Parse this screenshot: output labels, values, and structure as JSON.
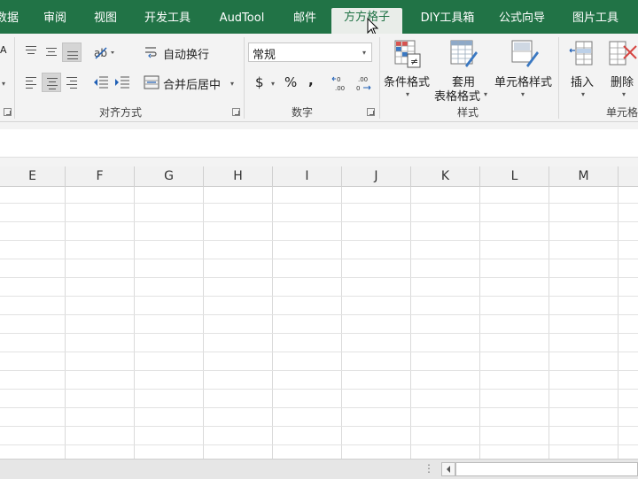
{
  "tabs": [
    "数据",
    "审阅",
    "视图",
    "开发工具",
    "AudTool",
    "邮件",
    "方方格子",
    "DIY工具箱",
    "公式向导",
    "图片工具"
  ],
  "active_tab": "方方格子",
  "alignment": {
    "wrap_text": "自动换行",
    "merge_center": "合并后居中",
    "group_label": "对齐方式"
  },
  "number": {
    "format_value": "常规",
    "currency_symbol": "$",
    "percent_symbol": "%",
    "comma_symbol": ",",
    "increase_decimal": "←0 .00",
    "decrease_decimal": ".00 →0",
    "group_label": "数字"
  },
  "styles": {
    "conditional_formatting": "条件格式",
    "format_as_table_line1": "套用",
    "format_as_table_line2": "表格格式",
    "cell_styles": "单元格样式",
    "group_label": "样式"
  },
  "cells": {
    "insert": "插入",
    "delete": "删除",
    "group_label": "单元格"
  },
  "columns": [
    "E",
    "F",
    "G",
    "H",
    "I",
    "J",
    "K",
    "L",
    "M"
  ],
  "colors": {
    "ribbon_tab_bg": "#217346",
    "ribbon_bg": "#f3f3f3",
    "grid_line": "#dadada"
  }
}
